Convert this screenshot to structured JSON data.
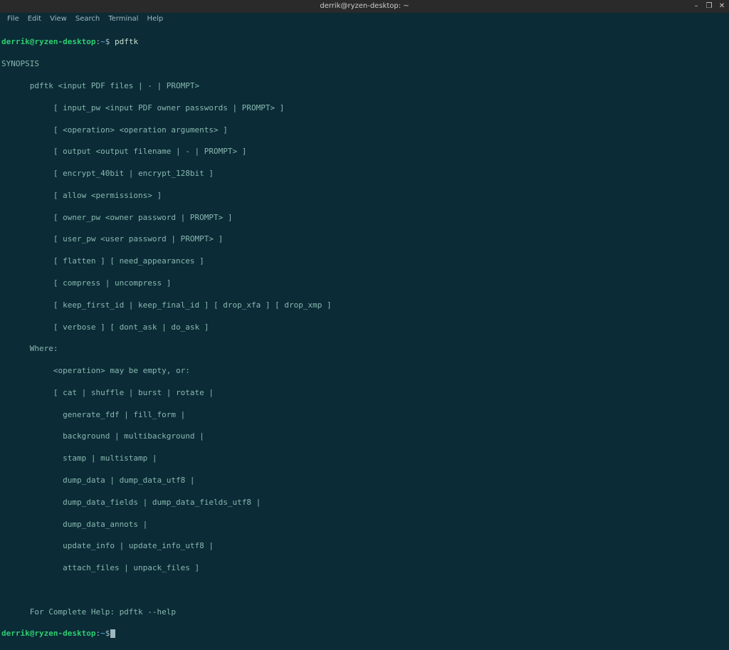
{
  "window": {
    "title": "derrik@ryzen-desktop: ~"
  },
  "controls": {
    "minimize": "–",
    "maximize": "❐",
    "close": "✕"
  },
  "menubar": {
    "items": [
      {
        "label": "File"
      },
      {
        "label": "Edit"
      },
      {
        "label": "View"
      },
      {
        "label": "Search"
      },
      {
        "label": "Terminal"
      },
      {
        "label": "Help"
      }
    ]
  },
  "prompt": {
    "user_host": "derrik@ryzen-desktop",
    "separator": ":",
    "path": "~",
    "dollar": "$"
  },
  "session": {
    "entered_command": " pdftk",
    "output_lines": [
      "SYNOPSIS",
      "      pdftk <input PDF files | - | PROMPT>",
      "           [ input_pw <input PDF owner passwords | PROMPT> ]",
      "           [ <operation> <operation arguments> ]",
      "           [ output <output filename | - | PROMPT> ]",
      "           [ encrypt_40bit | encrypt_128bit ]",
      "           [ allow <permissions> ]",
      "           [ owner_pw <owner password | PROMPT> ]",
      "           [ user_pw <user password | PROMPT> ]",
      "           [ flatten ] [ need_appearances ]",
      "           [ compress | uncompress ]",
      "           [ keep_first_id | keep_final_id ] [ drop_xfa ] [ drop_xmp ]",
      "           [ verbose ] [ dont_ask | do_ask ]",
      "      Where:",
      "           <operation> may be empty, or:",
      "           [ cat | shuffle | burst | rotate |",
      "             generate_fdf | fill_form |",
      "             background | multibackground |",
      "             stamp | multistamp |",
      "             dump_data | dump_data_utf8 |",
      "             dump_data_fields | dump_data_fields_utf8 |",
      "             dump_data_annots |",
      "             update_info | update_info_utf8 |",
      "             attach_files | unpack_files ]",
      "",
      "      For Complete Help: pdftk --help"
    ]
  }
}
